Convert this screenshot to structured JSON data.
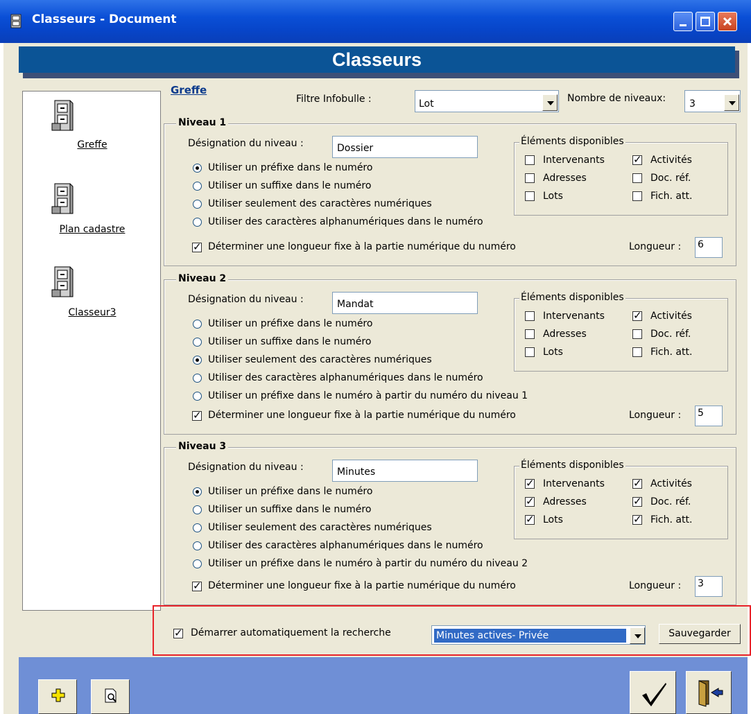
{
  "window": {
    "title": "Classeurs - Document"
  },
  "header": {
    "title": "Classeurs"
  },
  "sidebar": {
    "items": [
      {
        "label": "Greffe"
      },
      {
        "label": "Plan cadastre"
      },
      {
        "label": "Classeur3"
      }
    ]
  },
  "top": {
    "link": "Greffe",
    "filter_label": "Filtre Infobulle :",
    "filter_value": "Lot",
    "levels_label": "Nombre de niveaux:",
    "levels_value": "3"
  },
  "levels": [
    {
      "title": "Niveau 1",
      "designation_label": "Désignation du niveau :",
      "designation_value": "Dossier",
      "elements_title": "Éléments disponibles",
      "options": [
        {
          "label": "Utiliser un préfixe dans le numéro",
          "selected": true
        },
        {
          "label": "Utiliser un suffixe dans le numéro",
          "selected": false
        },
        {
          "label": "Utiliser seulement des caractères numériques",
          "selected": false
        },
        {
          "label": "Utiliser des caractères alphanumériques dans le numéro",
          "selected": false
        }
      ],
      "elements": [
        {
          "label": "Intervenants",
          "checked": false
        },
        {
          "label": "Activités",
          "checked": true
        },
        {
          "label": "Adresses",
          "checked": false
        },
        {
          "label": "Doc. réf.",
          "checked": false
        },
        {
          "label": "Lots",
          "checked": false
        },
        {
          "label": "Fich. att.",
          "checked": false
        }
      ],
      "fixed_length_label": "Déterminer une longueur fixe à la partie numérique du numéro",
      "fixed_length_checked": true,
      "length_label": "Longueur :",
      "length_value": "6"
    },
    {
      "title": "Niveau 2",
      "designation_label": "Désignation du niveau :",
      "designation_value": "Mandat",
      "elements_title": "Éléments disponibles",
      "options": [
        {
          "label": "Utiliser un préfixe dans le numéro",
          "selected": false
        },
        {
          "label": "Utiliser un suffixe dans le numéro",
          "selected": false
        },
        {
          "label": "Utiliser seulement des caractères numériques",
          "selected": true
        },
        {
          "label": "Utiliser des caractères alphanumériques dans le numéro",
          "selected": false
        },
        {
          "label": "Utiliser un préfixe dans le numéro à partir du numéro du niveau 1",
          "selected": false
        }
      ],
      "elements": [
        {
          "label": "Intervenants",
          "checked": false
        },
        {
          "label": "Activités",
          "checked": true
        },
        {
          "label": "Adresses",
          "checked": false
        },
        {
          "label": "Doc. réf.",
          "checked": false
        },
        {
          "label": "Lots",
          "checked": false
        },
        {
          "label": "Fich. att.",
          "checked": false
        }
      ],
      "fixed_length_label": "Déterminer une longueur fixe à la partie numérique du numéro",
      "fixed_length_checked": true,
      "length_label": "Longueur :",
      "length_value": "5"
    },
    {
      "title": "Niveau 3",
      "designation_label": "Désignation du niveau :",
      "designation_value": "Minutes",
      "elements_title": "Éléments disponibles",
      "options": [
        {
          "label": "Utiliser un préfixe dans le numéro",
          "selected": true
        },
        {
          "label": "Utiliser un suffixe dans le numéro",
          "selected": false
        },
        {
          "label": "Utiliser seulement des caractères numériques",
          "selected": false
        },
        {
          "label": "Utiliser des caractères alphanumériques dans le numéro",
          "selected": false
        },
        {
          "label": "Utiliser un préfixe dans le numéro à partir du numéro du niveau 2",
          "selected": false
        }
      ],
      "elements": [
        {
          "label": "Intervenants",
          "checked": true
        },
        {
          "label": "Activités",
          "checked": true
        },
        {
          "label": "Adresses",
          "checked": true
        },
        {
          "label": "Doc. réf.",
          "checked": true
        },
        {
          "label": "Lots",
          "checked": true
        },
        {
          "label": "Fich. att.",
          "checked": true
        }
      ],
      "fixed_length_label": "Déterminer une longueur fixe à la partie numérique du numéro",
      "fixed_length_checked": true,
      "length_label": "Longueur :",
      "length_value": "3"
    }
  ],
  "auto_search": {
    "label": "Démarrer automatiquement la recherche",
    "checked": true,
    "selected": "Minutes actives- Privée",
    "save_label": "Sauvegarder"
  },
  "colors": {
    "header": "#0b5496",
    "footer": "#6f8fd6",
    "highlight": "#e8232a",
    "selection": "#316ac5"
  }
}
